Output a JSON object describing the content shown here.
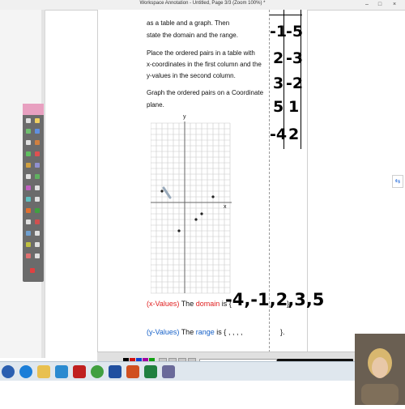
{
  "window": {
    "title": "Workspace Annotation - Untitled, Page 3/3 (Zoom 100%) *",
    "minimize": "–",
    "maximize": "□",
    "close": "×"
  },
  "instructions": {
    "line1": "as a table and a graph. Then",
    "line2": "state the domain and the range.",
    "line3": "Place the ordered pairs in a table with",
    "line4": "x-coordinates in the first column and the",
    "line5": "y-values in the second column.",
    "line6": "Graph the ordered pairs on a Coordinate",
    "line7": "plane."
  },
  "table": {
    "rows": [
      {
        "x": "-1",
        "y": "-5"
      },
      {
        "x": "2",
        "y": "-3"
      },
      {
        "x": "3",
        "y": "-2"
      },
      {
        "x": "5",
        "y": "1"
      },
      {
        "x": "-4",
        "y": "2"
      }
    ]
  },
  "graph": {
    "x_label": "x",
    "y_label": "y",
    "points": [
      {
        "x": -4,
        "y": 2
      },
      {
        "x": 5,
        "y": 1
      },
      {
        "x": 3,
        "y": -2
      },
      {
        "x": 2,
        "y": -3
      },
      {
        "x": -1,
        "y": -5
      }
    ]
  },
  "domain": {
    "prefix": "(x-Values)",
    "label_before": "The ",
    "keyword": "domain",
    "label_after": " is {",
    "values": "-4,-1,2,3,5",
    "close": "}."
  },
  "range": {
    "prefix": "(y-Values)",
    "label_before": "The ",
    "keyword": "range",
    "label_after": " is {",
    "values": ",   ,   ,   ,",
    "close": "}."
  },
  "colors": {
    "red": "#e02020",
    "blue": "#1560c8",
    "point": "#222222"
  },
  "icons": {
    "taskbar": [
      "start-icon",
      "ie-icon",
      "folder-icon",
      "media-icon",
      "acrobat-icon",
      "chrome-icon",
      "word-icon",
      "powerpoint-icon",
      "excel-icon",
      "app-icon"
    ]
  }
}
